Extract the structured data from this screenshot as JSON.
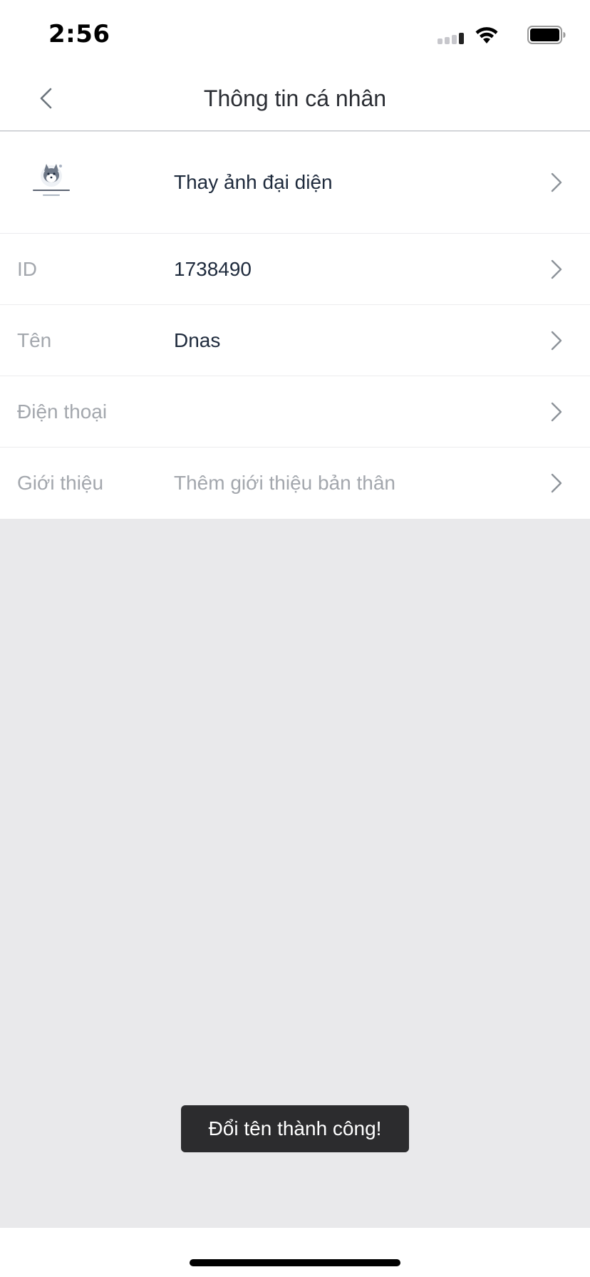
{
  "status_bar": {
    "time": "2:56"
  },
  "nav": {
    "title": "Thông tin cá nhân"
  },
  "profile": {
    "avatar_label": "Thay ảnh đại diện",
    "rows": [
      {
        "label": "ID",
        "value": "1738490",
        "placeholder": false
      },
      {
        "label": "Tên",
        "value": "Dnas",
        "placeholder": false
      },
      {
        "label": "Điện thoại",
        "value": "",
        "placeholder": false
      },
      {
        "label": "Giới thiệu",
        "value": "Thêm giới thiệu bản thân",
        "placeholder": true
      }
    ]
  },
  "toast": {
    "message": "Đổi tên thành công!"
  },
  "colors": {
    "background": "#e9e9eb",
    "label": "#a3a7ad",
    "value": "#1e2a3c",
    "toast_bg": "#2c2c2e"
  }
}
